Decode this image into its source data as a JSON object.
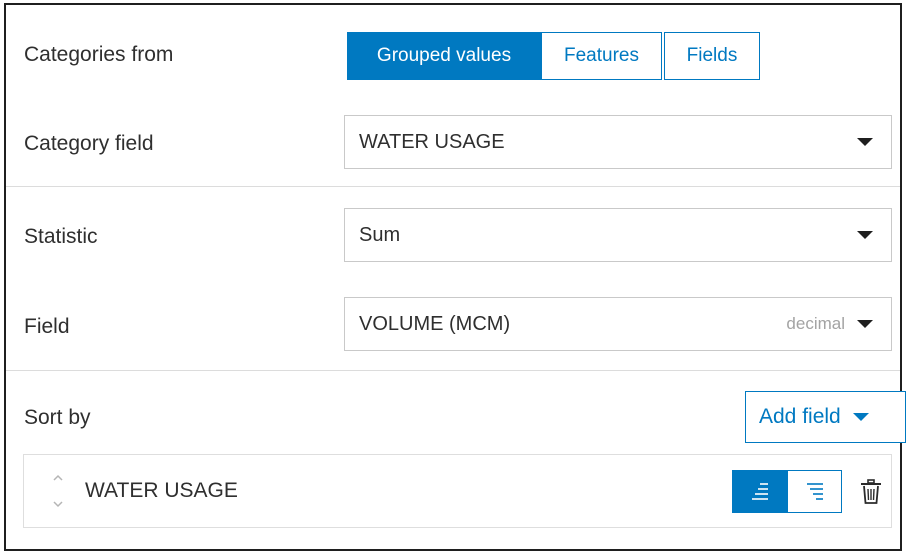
{
  "categories_from": {
    "label": "Categories from",
    "options": [
      "Grouped values",
      "Features",
      "Fields"
    ],
    "selected": "Grouped values"
  },
  "category_field": {
    "label": "Category field",
    "value": "WATER USAGE"
  },
  "statistic": {
    "label": "Statistic",
    "value": "Sum"
  },
  "field": {
    "label": "Field",
    "value": "VOLUME (MCM)",
    "type_hint": "decimal"
  },
  "sort_by": {
    "label": "Sort by",
    "add_field_label": "Add field",
    "items": [
      {
        "name": "WATER USAGE",
        "direction": "ascending"
      }
    ]
  },
  "colors": {
    "accent": "#0079c1",
    "text": "#2f2f2f",
    "muted": "#a3a3a3",
    "border": "#c9c9c9"
  },
  "icons": [
    "chevron-down-icon",
    "drag-handle-icon",
    "sort-ascending-icon",
    "sort-descending-icon",
    "trash-icon"
  ]
}
